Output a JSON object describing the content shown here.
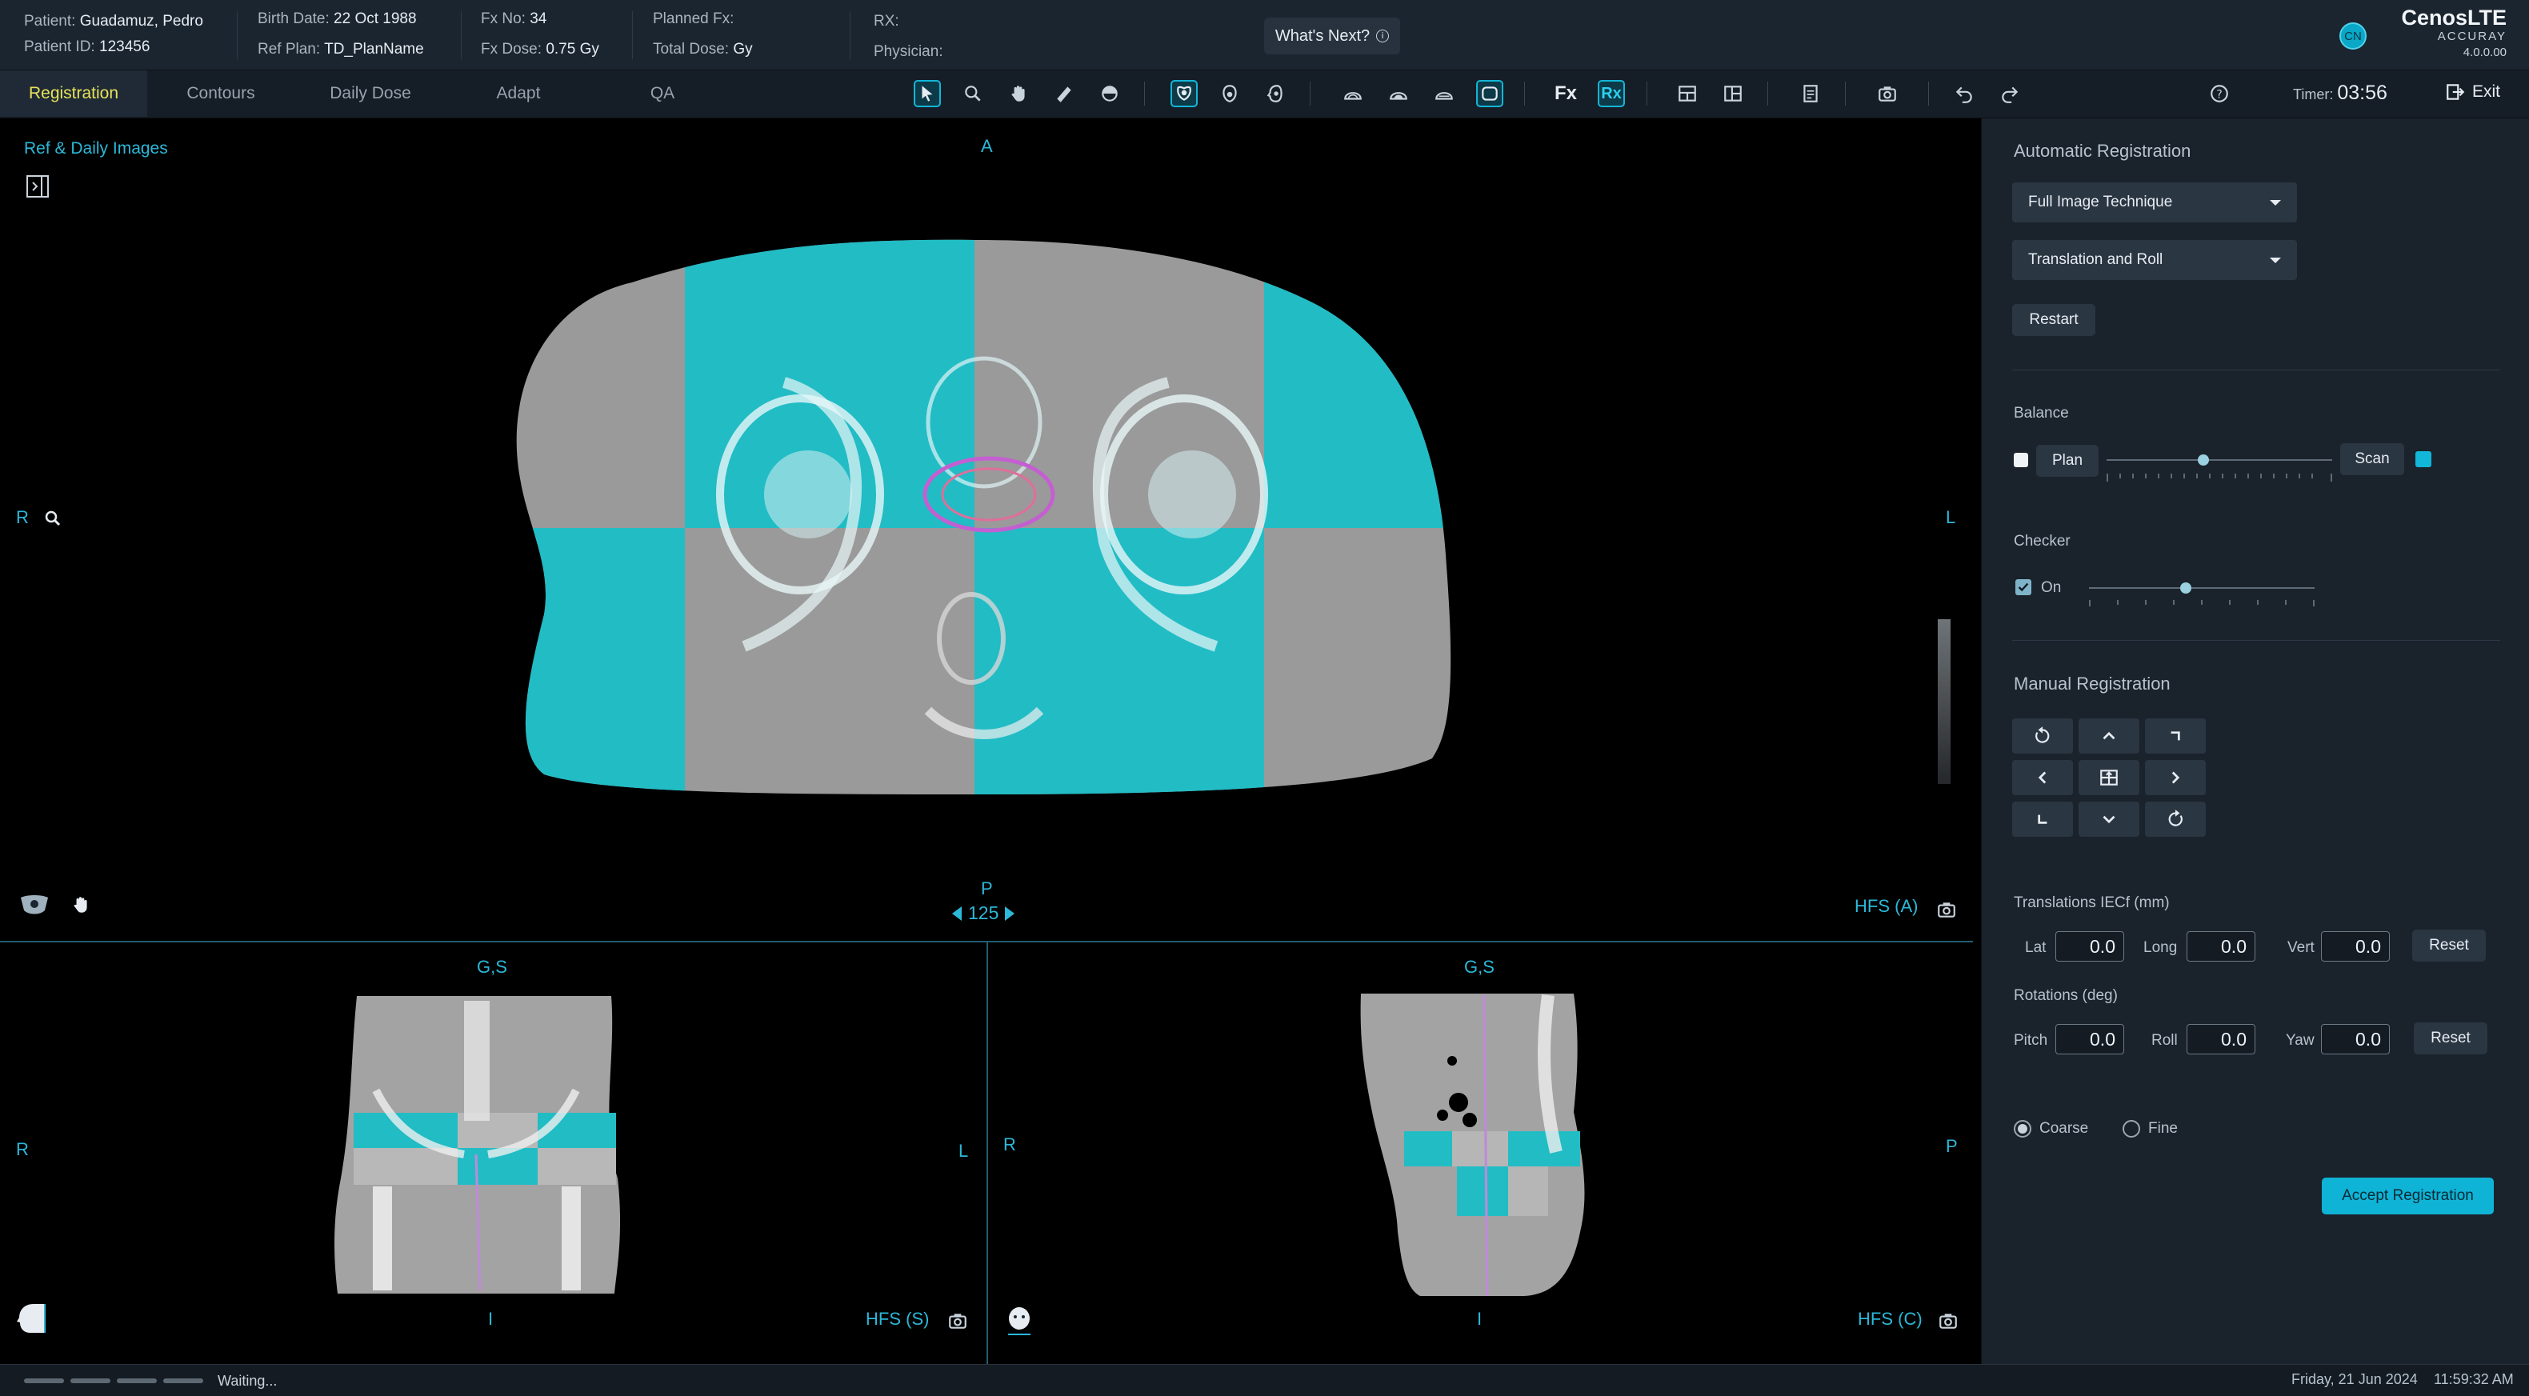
{
  "header": {
    "patient_label": "Patient:",
    "patient_name": "Guadamuz, Pedro",
    "patient_id_label": "Patient ID:",
    "patient_id": "123456",
    "birth_date_label": "Birth Date:",
    "birth_date": "22 Oct 1988",
    "ref_plan_label": "Ref Plan:",
    "ref_plan": "TD_PlanName",
    "fx_no_label": "Fx No:",
    "fx_no": "34",
    "fx_dose_label": "Fx Dose:",
    "fx_dose": "0.75 Gy",
    "planned_fx_label": "Planned Fx:",
    "total_dose_label": "Total Dose:",
    "total_dose": "Gy",
    "rx_label": "RX:",
    "physician_label": "Physician:",
    "whats_next": "What's Next?",
    "avatar_initials": "CN",
    "brand_name": "CenosLTE",
    "brand_sub": "ACCURAY",
    "version": "4.0.0.00"
  },
  "tabs": [
    {
      "label": "Registration",
      "active": true
    },
    {
      "label": "Contours",
      "active": false
    },
    {
      "label": "Daily Dose",
      "active": false
    },
    {
      "label": "Adapt",
      "active": false
    },
    {
      "label": "QA",
      "active": false
    }
  ],
  "toolbar": {
    "fx_label": "Fx",
    "rx_label": "Rx",
    "timer_label": "Timer:",
    "timer_value": "03:56",
    "exit_label": "Exit"
  },
  "viewer": {
    "ref_daily_label": "Ref & Daily Images",
    "axial": {
      "top": "A",
      "bottom": "P",
      "left": "R",
      "right": "L",
      "slice": "125",
      "orientation": "HFS (A)"
    },
    "coronal": {
      "top": "G,S",
      "bottom": "I",
      "left": "R",
      "right": "L",
      "orientation": "HFS (S)"
    },
    "sagittal": {
      "top": "G,S",
      "bottom": "I",
      "left": "R",
      "right": "P",
      "orientation": "HFS (C)"
    }
  },
  "panel": {
    "auto_reg_title": "Automatic Registration",
    "technique_value": "Full Image Technique",
    "dof_value": "Translation and Roll",
    "restart_label": "Restart",
    "balance_title": "Balance",
    "plan_label": "Plan",
    "scan_label": "Scan",
    "balance_level": 0.43,
    "checker_title": "Checker",
    "checker_on_label": "On",
    "checker_checked": true,
    "checker_level": 0.43,
    "manual_reg_title": "Manual Registration",
    "translations_title": "Translations IECf (mm)",
    "lat_label": "Lat",
    "lat_value": "0.0",
    "long_label": "Long",
    "long_value": "0.0",
    "vert_label": "Vert",
    "vert_value": "0.0",
    "reset_label": "Reset",
    "rotations_title": "Rotations (deg)",
    "pitch_label": "Pitch",
    "pitch_value": "0.0",
    "roll_label": "Roll",
    "roll_value": "0.0",
    "yaw_label": "Yaw",
    "yaw_value": "0.0",
    "coarse_label": "Coarse",
    "fine_label": "Fine",
    "resolution_selected": "Coarse",
    "accept_label": "Accept Registration"
  },
  "status": {
    "message": "Waiting...",
    "date": "Friday, 21 Jun 2024",
    "time": "11:59:32 AM"
  },
  "colors": {
    "accent": "#12b6d8",
    "active_tab": "#e7e25a",
    "orientation_text": "#2cb8d8",
    "background": "#1a222b"
  }
}
